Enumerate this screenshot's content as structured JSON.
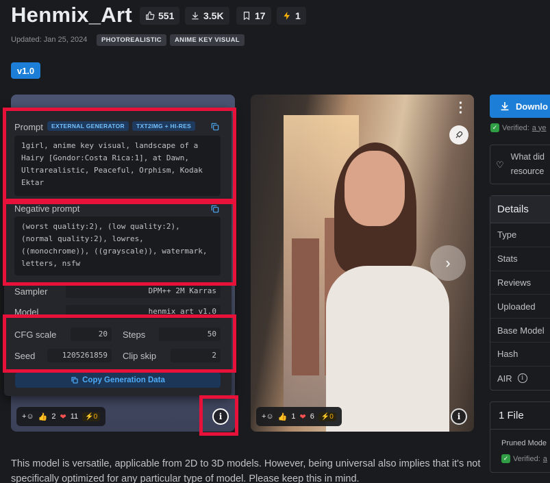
{
  "header": {
    "title": "Henmix_Art",
    "stats": {
      "likes": "551",
      "downloads": "3.5K",
      "bookmarks": "17",
      "buzz": "1"
    },
    "updated": "Updated: Jan 25, 2024",
    "tags": [
      "PHOTOREALISTIC",
      "ANIME KEY VISUAL"
    ],
    "version": "v1.0"
  },
  "generation": {
    "prompt_label": "Prompt",
    "badges": [
      "EXTERNAL GENERATOR",
      "TXT2IMG + HI-RES"
    ],
    "prompt": "1girl, anime key visual, landscape of a Hairy [Gondor:Costa Rica:1], at Dawn, Ultrarealistic, Peaceful, Orphism, Kodak Ektar",
    "negative_label": "Negative prompt",
    "negative": "(worst quality:2), (low quality:2), (normal quality:2), lowres, ((monochrome)), ((grayscale)), watermark, letters, nsfw",
    "sampler_label": "Sampler",
    "sampler": "DPM++ 2M Karras",
    "model_label": "Model",
    "model": "henmix_art_v1.0",
    "cfg_label": "CFG scale",
    "cfg": "20",
    "steps_label": "Steps",
    "steps": "50",
    "seed_label": "Seed",
    "seed": "1205261859",
    "clip_label": "Clip skip",
    "clip": "2",
    "copy_button": "Copy Generation Data"
  },
  "card1_reactions": {
    "likes": "2",
    "hearts": "11",
    "buzz": "0"
  },
  "card2_reactions": {
    "likes": "1",
    "hearts": "6",
    "buzz": "0"
  },
  "sidebar": {
    "download_label": "Downlo",
    "verified": "Verified:",
    "verified_when": "a ye",
    "what_did": "What did",
    "resource": "resource",
    "details_title": "Details",
    "details_rows": [
      "Type",
      "Stats",
      "Reviews",
      "Uploaded",
      "Base Model",
      "Hash",
      "AIR"
    ],
    "files_title": "1 File",
    "file_name": "Pruned Mode",
    "file_verified": "Verified:",
    "file_verified_when": "a"
  },
  "description": "This model is versatile, applicable from 2D to 3D models. However, being universal also implies that it's not specifically optimized for any particular type of model. Please keep this in mind.",
  "colors": {
    "accent": "#1c7ed6",
    "highlight": "#e8113a",
    "background": "#1a1b1e"
  }
}
